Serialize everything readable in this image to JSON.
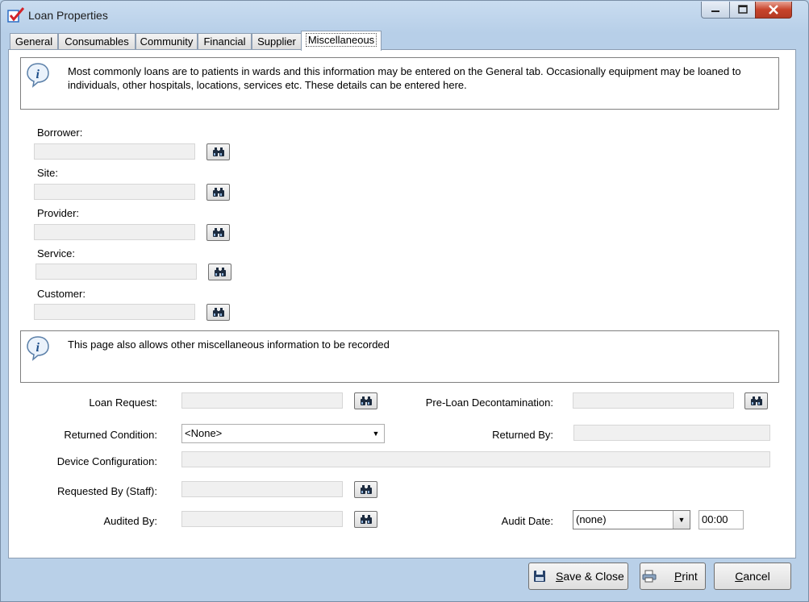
{
  "window": {
    "title": "Loan Properties"
  },
  "tabs": [
    {
      "label": "General"
    },
    {
      "label": "Consumables"
    },
    {
      "label": "Community"
    },
    {
      "label": "Financial"
    },
    {
      "label": "Supplier"
    },
    {
      "label": "Miscellaneous",
      "selected": true
    }
  ],
  "info_top": {
    "text": "Most commonly loans are to patients in wards and this information may be entered on the General tab. Occasionally equipment may be loaned to individuals, other hospitals, locations, services etc. These details can be entered here."
  },
  "fields_left": {
    "borrower_label": "Borrower:",
    "borrower_value": "",
    "site_label": "Site:",
    "site_value": "",
    "provider_label": "Provider:",
    "provider_value": "",
    "service_label": "Service:",
    "service_value": "",
    "customer_label": "Customer:",
    "customer_value": ""
  },
  "info_bottom": {
    "text": "This page also allows other miscellaneous information to be recorded"
  },
  "misc": {
    "loan_request_label": "Loan Request:",
    "loan_request_value": "",
    "pre_loan_label": "Pre-Loan Decontamination:",
    "pre_loan_value": "",
    "returned_condition_label": "Returned Condition:",
    "returned_condition_value": "<None>",
    "returned_by_label": "Returned By:",
    "returned_by_value": "",
    "device_config_label": "Device Configuration:",
    "device_config_value": "",
    "requested_by_label": "Requested By (Staff):",
    "requested_by_value": "",
    "audited_by_label": "Audited By:",
    "audited_by_value": "",
    "audit_date_label": "Audit Date:",
    "audit_date_value": "(none)",
    "audit_time_value": "00:00"
  },
  "buttons": {
    "save_close_mnemonic": "S",
    "save_close_rest": "ave & Close",
    "print_mnemonic": "P",
    "print_rest": "rint",
    "cancel_mnemonic": "C",
    "cancel_rest": "ancel"
  },
  "colors": {
    "accent": "#2b6cc4",
    "window_frame": "#b9d0e8",
    "field_bg": "#f0f0f0"
  }
}
